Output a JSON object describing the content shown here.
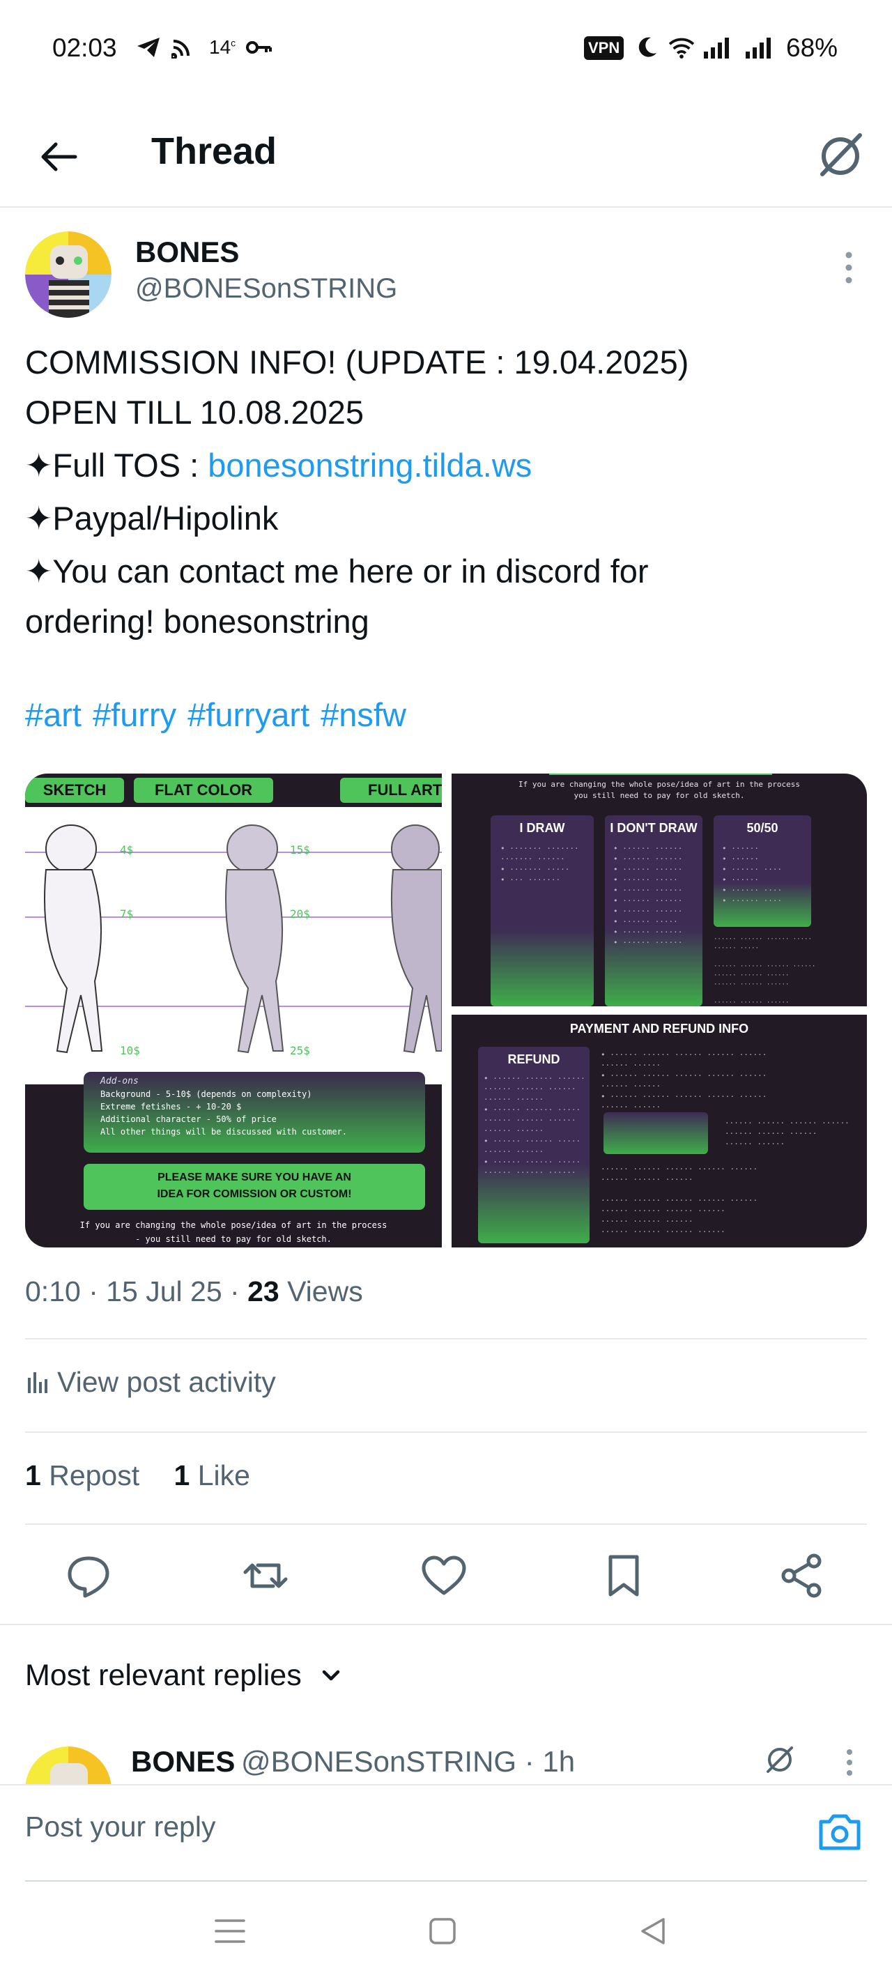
{
  "status_bar": {
    "time": "02:03",
    "temperature": "14",
    "battery": "68%",
    "vpn_label": "VPN"
  },
  "header": {
    "title": "Thread"
  },
  "post": {
    "author_name": "BONES",
    "author_handle": "@BONESonSTRING",
    "lines": {
      "l1": "COMMISSION INFO! (UPDATE : 19.04.2025)",
      "l2": "OPEN TILL 10.08.2025",
      "l3_prefix": "✦Full TOS : ",
      "l3_link": "bonesonstring.tilda.ws",
      "l4": "✦Paypal/Hipolink",
      "l5a": "✦You can contact me here or in discord for",
      "l5b": "ordering! bonesonstring"
    },
    "hashtags": [
      "#art",
      "#furry",
      "#furryart",
      "#nsfw"
    ],
    "time": "0:10 · 15 Jul 25 · ",
    "views_count": "23",
    "views_label": " Views",
    "activity_label": "View post activity",
    "reposts_count": "1",
    "reposts_label": " Repost",
    "likes_count": "1",
    "likes_label": " Like"
  },
  "media": {
    "image1": {
      "tabs": [
        "SKETCH",
        "FLAT COLOR",
        "FULL ART"
      ],
      "prices_row1": [
        "4$",
        "15$"
      ],
      "prices_row2": [
        "7$",
        "20$"
      ],
      "prices_row3": [
        "10$",
        "25$"
      ],
      "addons_title": "Add-ons",
      "addons": [
        "Background - 5-10$ (depends on complexity)",
        "Extreme fetishes - + 10-20 $",
        "Additional character - 50% of price",
        "All other things will be discussed with customer."
      ],
      "notice_1": "PLEASE MAKE SURE YOU HAVE AN",
      "notice_2": "IDEA FOR COMISSION OR CUSTOM!",
      "footer_1": "If you are changing the whole pose/idea of art in the process",
      "footer_2": "- you still need to pay for old sketch."
    },
    "image2": {
      "top_1": "If you are changing the whole pose/idea of art in the process",
      "top_2": "you still need to pay for old sketch.",
      "col1": "I DRAW",
      "col2": "I DON'T DRAW",
      "col3": "50/50"
    },
    "image3": {
      "title": "PAYMENT AND REFUND INFO",
      "refund": "REFUND"
    }
  },
  "replies": {
    "sort_label": "Most relevant replies",
    "first": {
      "author_name": "BONES",
      "author_handle": "@BONESonSTRING · 1h"
    }
  },
  "composer": {
    "placeholder": "Post your reply"
  },
  "colors": {
    "link": "#1d9bf0",
    "secondary_text": "#536471",
    "accent_green": "#4fc45a",
    "media_bg": "#221b26"
  }
}
